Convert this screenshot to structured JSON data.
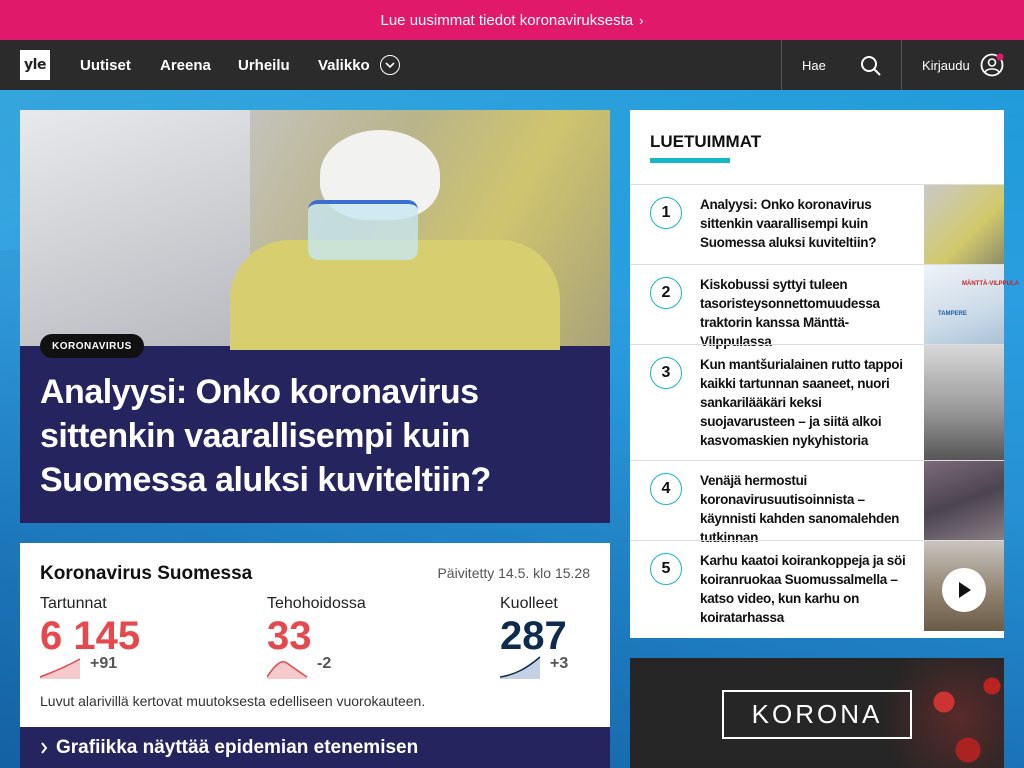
{
  "banner": {
    "text": "Lue uusimmat tiedot koronaviruksesta",
    "chevron": "›"
  },
  "nav": {
    "logo": "yle",
    "items": [
      {
        "label": "Uutiset"
      },
      {
        "label": "Areena"
      },
      {
        "label": "Urheilu"
      },
      {
        "label": "Valikko"
      }
    ],
    "search_label": "Hae",
    "login_label": "Kirjaudu"
  },
  "hero": {
    "tag": "KORONAVIRUS",
    "title": "Analyysi: Onko koronavirus sittenkin vaarallisempi kuin Suomessa aluksi kuviteltiin?"
  },
  "stats": {
    "title": "Koronavirus Suomessa",
    "updated": "Päivitetty 14.5. klo 15.28",
    "items": [
      {
        "label": "Tartunnat",
        "value": "6 145",
        "change": "+91",
        "color": "#e5484d"
      },
      {
        "label": "Tehohoidossa",
        "value": "33",
        "change": "-2",
        "color": "#e5484d"
      },
      {
        "label": "Kuolleet",
        "value": "287",
        "change": "+3",
        "color": "#0e2a4f"
      }
    ],
    "note": "Luvut alarivillä kertovat muutoksesta edelliseen vuorokauteen."
  },
  "graph_link": {
    "label": "Grafiikka näyttää epidemian etenemisen"
  },
  "most_read": {
    "title": "LUETUIMMAT",
    "items": [
      {
        "rank": "1",
        "text": "Analyysi: Onko koronavirus sittenkin vaarallisempi kuin Suomessa aluksi kuviteltiin?"
      },
      {
        "rank": "2",
        "text": "Kiskobussi syttyi tuleen tasoristeysonnettomuudessa traktorin kanssa Mänttä-Vilppulassa"
      },
      {
        "rank": "3",
        "text": "Kun mantšurialainen rutto tappoi kaikki tartunnan saaneet, nuori sankarilääkäri keksi suojavarusteen – ja siitä alkoi kasvomaskien nykyhistoria"
      },
      {
        "rank": "4",
        "text": "Venäjä hermostui koronavirusuutisoinnista – käynnisti kahden sanomalehden tutkinnan"
      },
      {
        "rank": "5",
        "text": "Karhu kaatoi koirankoppeja ja söi koiranruokaa Suomussalmella – katso video, kun karhu on koiratarhassa"
      }
    ],
    "map_label": "MÄNTTÄ-VILPPULA",
    "map_label2": "TAMPERE"
  },
  "korona_box": {
    "label": "KORONA"
  },
  "colors": {
    "accent": "#e0196a",
    "nav_bg": "#2b2b2b",
    "hero_bg": "#25245f",
    "teal": "#16b7c8"
  }
}
